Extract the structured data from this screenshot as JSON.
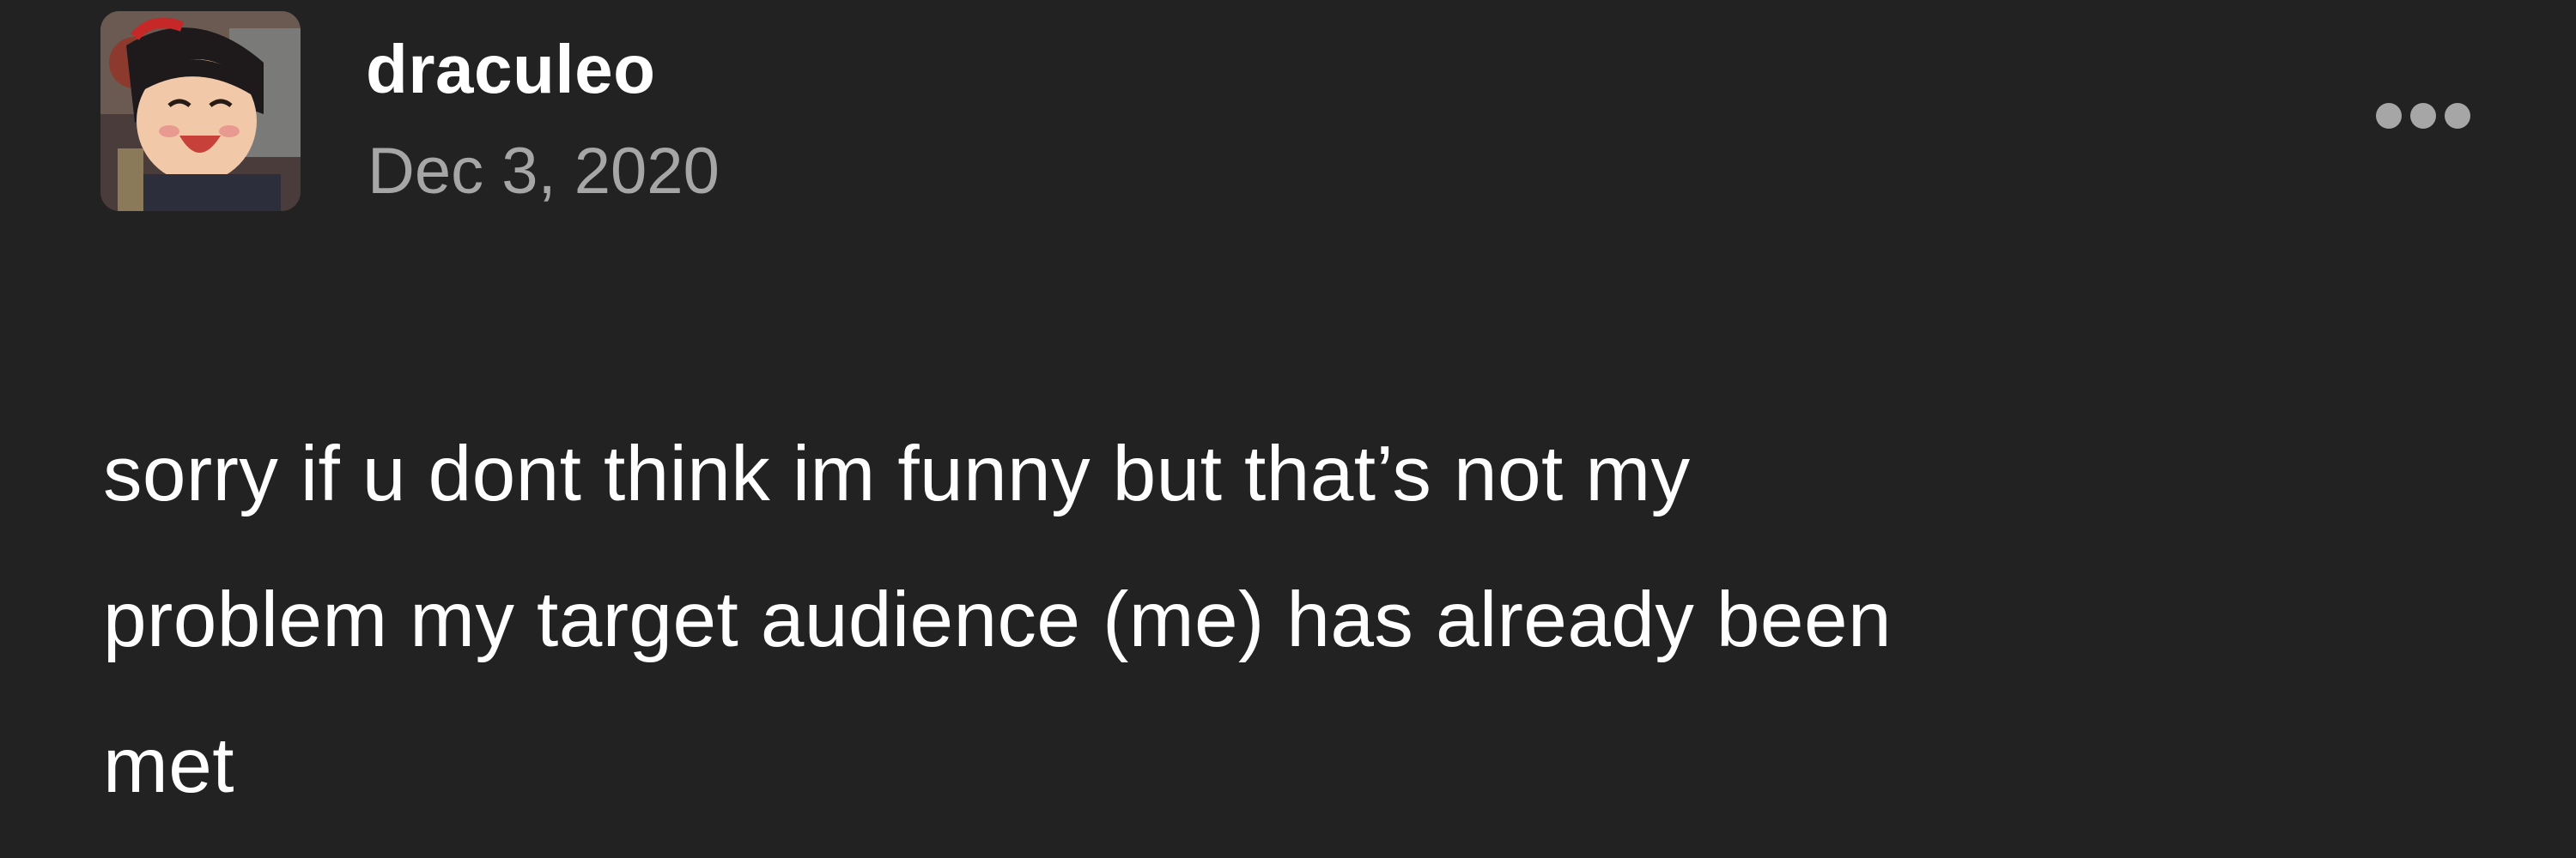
{
  "post": {
    "author": {
      "username": "draculeo",
      "avatar_icon": "avatar-icon"
    },
    "date": "Dec 3, 2020",
    "more_icon": "ellipsis-icon",
    "body_lines": [
      "sorry if u dont think im funny but that’s not my",
      "problem my target audience (me) has already been",
      "met"
    ]
  },
  "colors": {
    "background": "#222222",
    "text": "#ffffff",
    "secondary_text": "#a6a6a6"
  }
}
